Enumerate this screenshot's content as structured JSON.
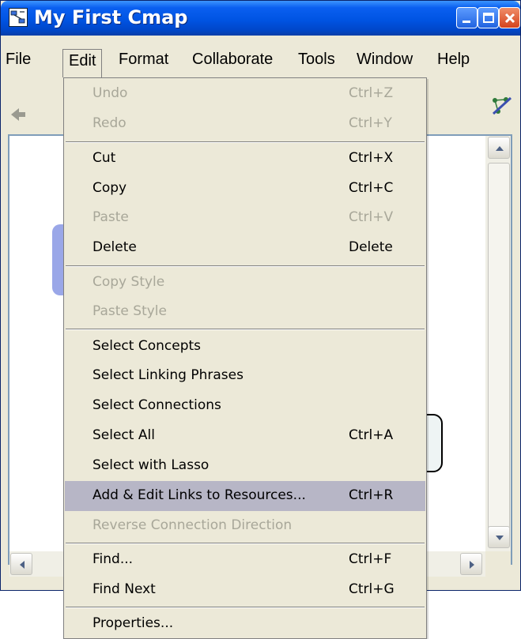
{
  "window": {
    "title": "My First Cmap",
    "icon": "cmap-app-icon",
    "controls": [
      "minimize-icon",
      "maximize-icon",
      "close-icon"
    ]
  },
  "menubar": {
    "items": [
      {
        "label": "File"
      },
      {
        "label": "Edit"
      },
      {
        "label": "Format"
      },
      {
        "label": "Collaborate"
      },
      {
        "label": "Tools"
      },
      {
        "label": "Window"
      },
      {
        "label": "Help"
      }
    ]
  },
  "edit_menu": {
    "groups": [
      [
        {
          "label": "Undo",
          "accel": "Ctrl+Z",
          "enabled": false
        },
        {
          "label": "Redo",
          "accel": "Ctrl+Y",
          "enabled": false
        }
      ],
      [
        {
          "label": "Cut",
          "accel": "Ctrl+X",
          "enabled": true
        },
        {
          "label": "Copy",
          "accel": "Ctrl+C",
          "enabled": true
        },
        {
          "label": "Paste",
          "accel": "Ctrl+V",
          "enabled": false
        },
        {
          "label": "Delete",
          "accel": "Delete",
          "enabled": true
        }
      ],
      [
        {
          "label": "Copy Style",
          "accel": "",
          "enabled": false
        },
        {
          "label": "Paste Style",
          "accel": "",
          "enabled": false
        }
      ],
      [
        {
          "label": "Select Concepts",
          "accel": "",
          "enabled": true
        },
        {
          "label": "Select Linking Phrases",
          "accel": "",
          "enabled": true
        },
        {
          "label": "Select Connections",
          "accel": "",
          "enabled": true
        },
        {
          "label": "Select All",
          "accel": "Ctrl+A",
          "enabled": true
        },
        {
          "label": "Select with Lasso",
          "accel": "",
          "enabled": true
        },
        {
          "label": "Add & Edit Links to Resources...",
          "accel": "Ctrl+R",
          "enabled": true,
          "highlighted": true
        },
        {
          "label": "Reverse Connection Direction",
          "accel": "",
          "enabled": false
        }
      ],
      [
        {
          "label": "Find...",
          "accel": "Ctrl+F",
          "enabled": true
        },
        {
          "label": "Find Next",
          "accel": "Ctrl+G",
          "enabled": true
        }
      ],
      [
        {
          "label": "Properties...",
          "accel": "",
          "enabled": true
        }
      ]
    ]
  },
  "toolbar": {
    "left_icon": "back-arrow-icon",
    "right_icon": "hide-network-icon"
  },
  "colors": {
    "titlebar": "#0054e3",
    "menu_bg": "#ece9d8",
    "highlight": "#b7b6c6",
    "disabled_text": "#a8a799"
  }
}
